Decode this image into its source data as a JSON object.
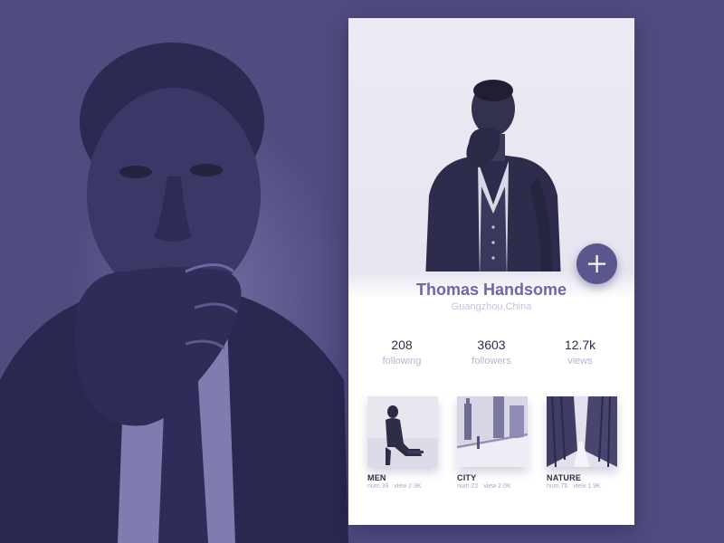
{
  "profile": {
    "name": "Thomas Handsome",
    "location": "Guangzhou,China"
  },
  "stats": [
    {
      "value": "208",
      "label": "following"
    },
    {
      "value": "3603",
      "label": "followers"
    },
    {
      "value": "12.7k",
      "label": "views"
    }
  ],
  "albums": [
    {
      "title": "MEN",
      "num": "num.39",
      "views": "view 2.9K"
    },
    {
      "title": "CITY",
      "num": "num.22",
      "views": "view 2.0K"
    },
    {
      "title": "NATURE",
      "num": "num.76",
      "views": "view 1.9K"
    }
  ],
  "actions": {
    "add_icon": "plus-icon"
  },
  "colors": {
    "background": "#4f4c80",
    "accent": "#5a578f",
    "name": "#6b69a3",
    "muted": "#b6b5cf"
  }
}
